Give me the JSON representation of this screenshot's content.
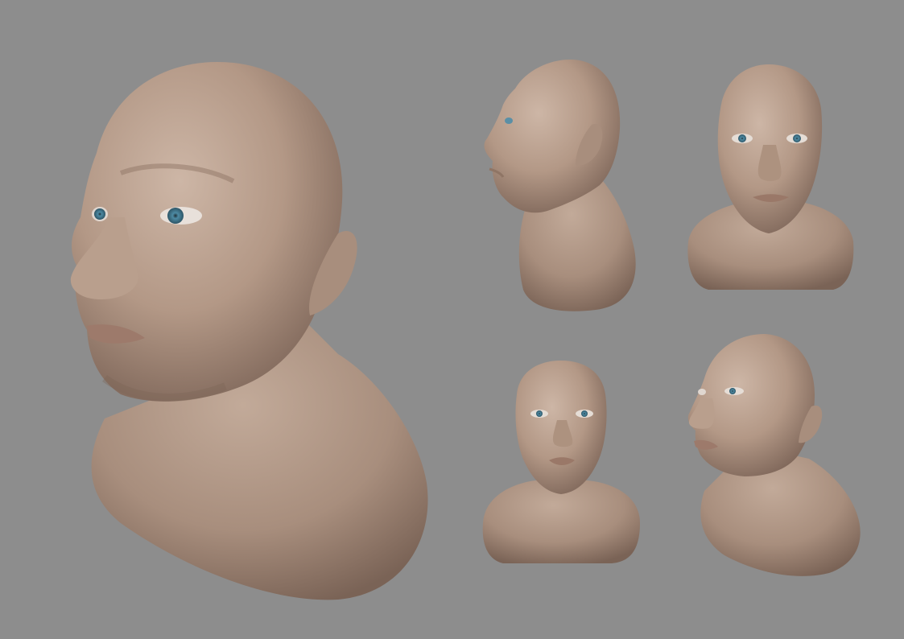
{
  "scene": {
    "background_color": "#8d8d8d",
    "skin_color": "#b39886",
    "skin_shadow_color": "#7f675a",
    "skin_highlight_color": "#cdb6a6",
    "iris_color": "#5a8fa6"
  },
  "renders": [
    {
      "view": "three-quarter-left-large"
    },
    {
      "view": "profile-left"
    },
    {
      "view": "front"
    },
    {
      "view": "front-small"
    },
    {
      "view": "three-quarter-left-small"
    }
  ]
}
